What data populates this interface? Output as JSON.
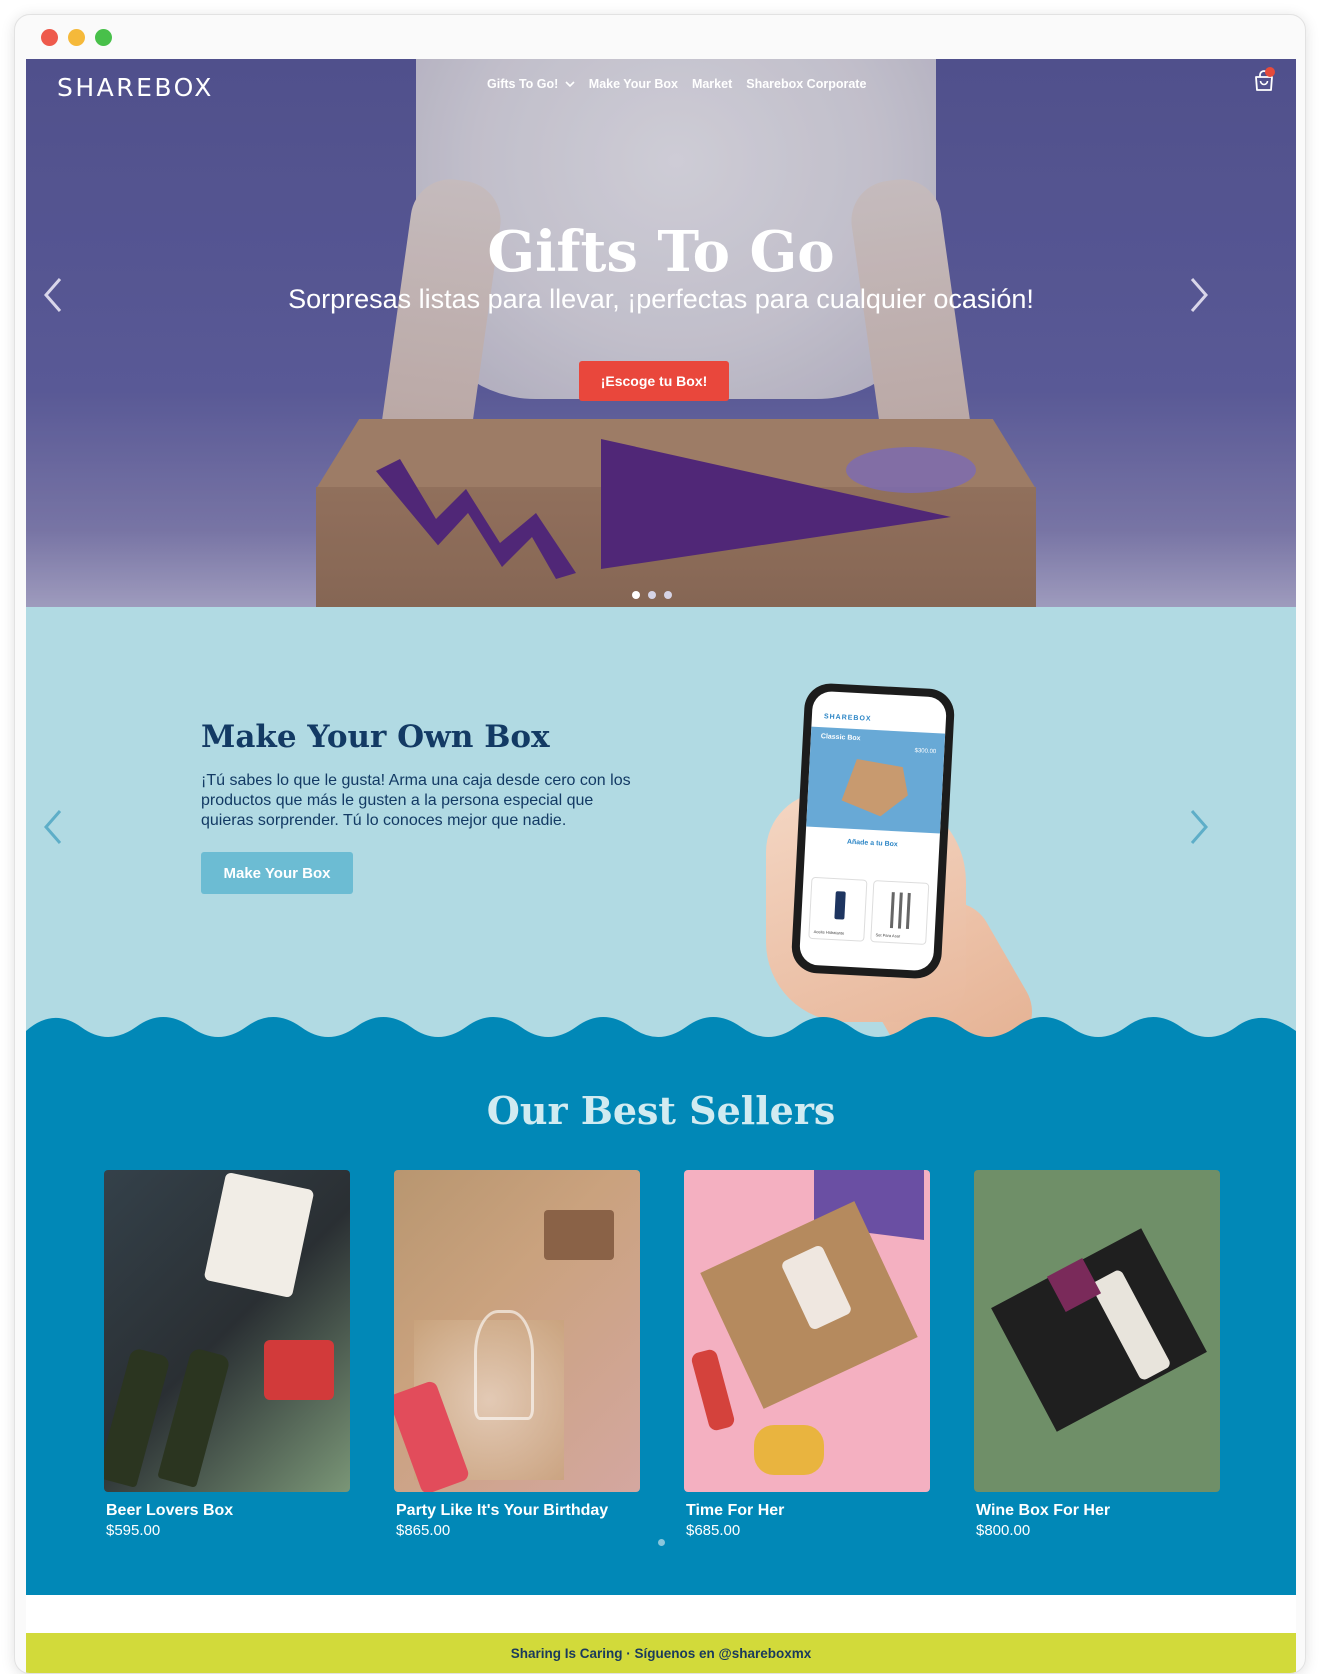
{
  "nav": {
    "logo": "SHAREBOX",
    "items": [
      "Gifts To Go!",
      "Make Your Box",
      "Market",
      "Sharebox Corporate"
    ]
  },
  "hero": {
    "title": "Gifts To Go",
    "subtitle": "Sorpresas listas para llevar, ¡perfectas para cualquier ocasión!",
    "button": "¡Escoge tu Box!",
    "slide_count": 3,
    "active_slide": 1
  },
  "make_your_own": {
    "title": "Make Your Own Box",
    "text": "¡Tú sabes lo que le gusta! Arma una caja desde cero con los productos que más le gusten a la persona especial que quieras sorprender. Tú lo conoces mejor que nadie.",
    "button": "Make Your Box",
    "phone": {
      "logo": "SHAREBOX",
      "box_title": "Classic Box",
      "box_price": "$300.00",
      "add_label": "Añade a tu Box",
      "product1": "Aceite Hidratante",
      "product2": "Set Para Asar"
    }
  },
  "best_sellers": {
    "title": "Our Best Sellers",
    "products": [
      {
        "name": "Beer Lovers Box",
        "price": "$595.00"
      },
      {
        "name": "Party Like It's Your Birthday",
        "price": "$865.00"
      },
      {
        "name": "Time For Her",
        "price": "$685.00"
      },
      {
        "name": "Wine Box For Her",
        "price": "$800.00"
      }
    ]
  },
  "banner": {
    "text": "Sharing Is Caring · Síguenos en @shareboxmx"
  },
  "colors": {
    "hero_button": "#e9473c",
    "myob_bg": "#b1dae3",
    "myob_button": "#6cbcd3",
    "sellers_bg": "#0188b7",
    "banner_bg": "#d2da3a",
    "navy_text": "#133a64"
  }
}
